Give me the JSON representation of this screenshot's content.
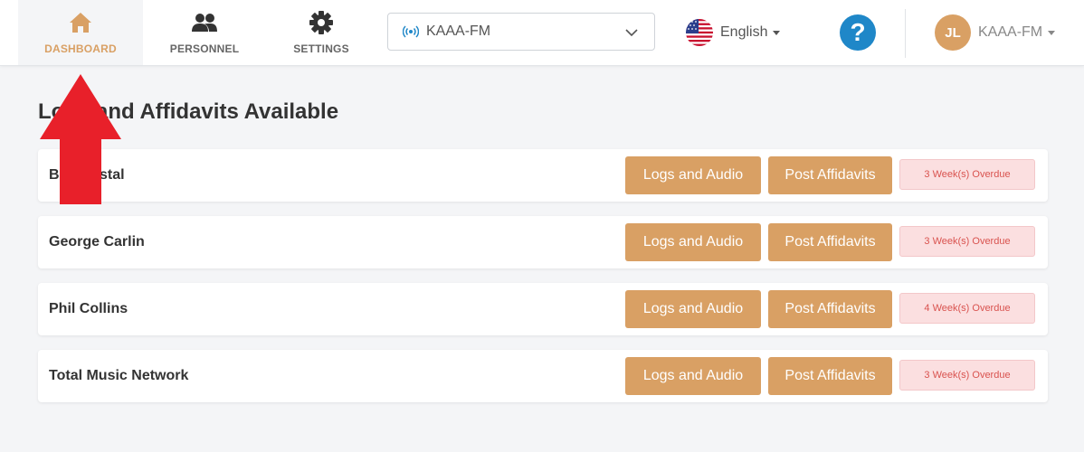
{
  "nav": {
    "items": [
      {
        "label": "DASHBOARD",
        "icon": "home-icon",
        "active": true
      },
      {
        "label": "PERSONNEL",
        "icon": "users-icon",
        "active": false
      },
      {
        "label": "SETTINGS",
        "icon": "gear-icon",
        "active": false
      }
    ]
  },
  "station_select": {
    "value": "KAAA-FM",
    "icon": "broadcast-icon"
  },
  "language": {
    "label": "English",
    "icon": "us-flag-icon"
  },
  "help": {
    "label": "?"
  },
  "user": {
    "initials": "JL",
    "name": "KAAA-FM"
  },
  "page": {
    "title": "Logs and Affidavits Available"
  },
  "rows": [
    {
      "name": "Bill Crystal",
      "logs_label": "Logs and Audio",
      "post_label": "Post Affidavits",
      "status": "3 Week(s) Overdue"
    },
    {
      "name": "George Carlin",
      "logs_label": "Logs and Audio",
      "post_label": "Post Affidavits",
      "status": "3 Week(s) Overdue"
    },
    {
      "name": "Phil Collins",
      "logs_label": "Logs and Audio",
      "post_label": "Post Affidavits",
      "status": "4 Week(s) Overdue"
    },
    {
      "name": "Total Music Network",
      "logs_label": "Logs and Audio",
      "post_label": "Post Affidavits",
      "status": "3 Week(s) Overdue"
    }
  ],
  "colors": {
    "accent": "#d9a064",
    "help": "#1f87c8",
    "overdue_bg": "#fbdfe0",
    "overdue_text": "#d9534f",
    "arrow": "#e8202a"
  }
}
